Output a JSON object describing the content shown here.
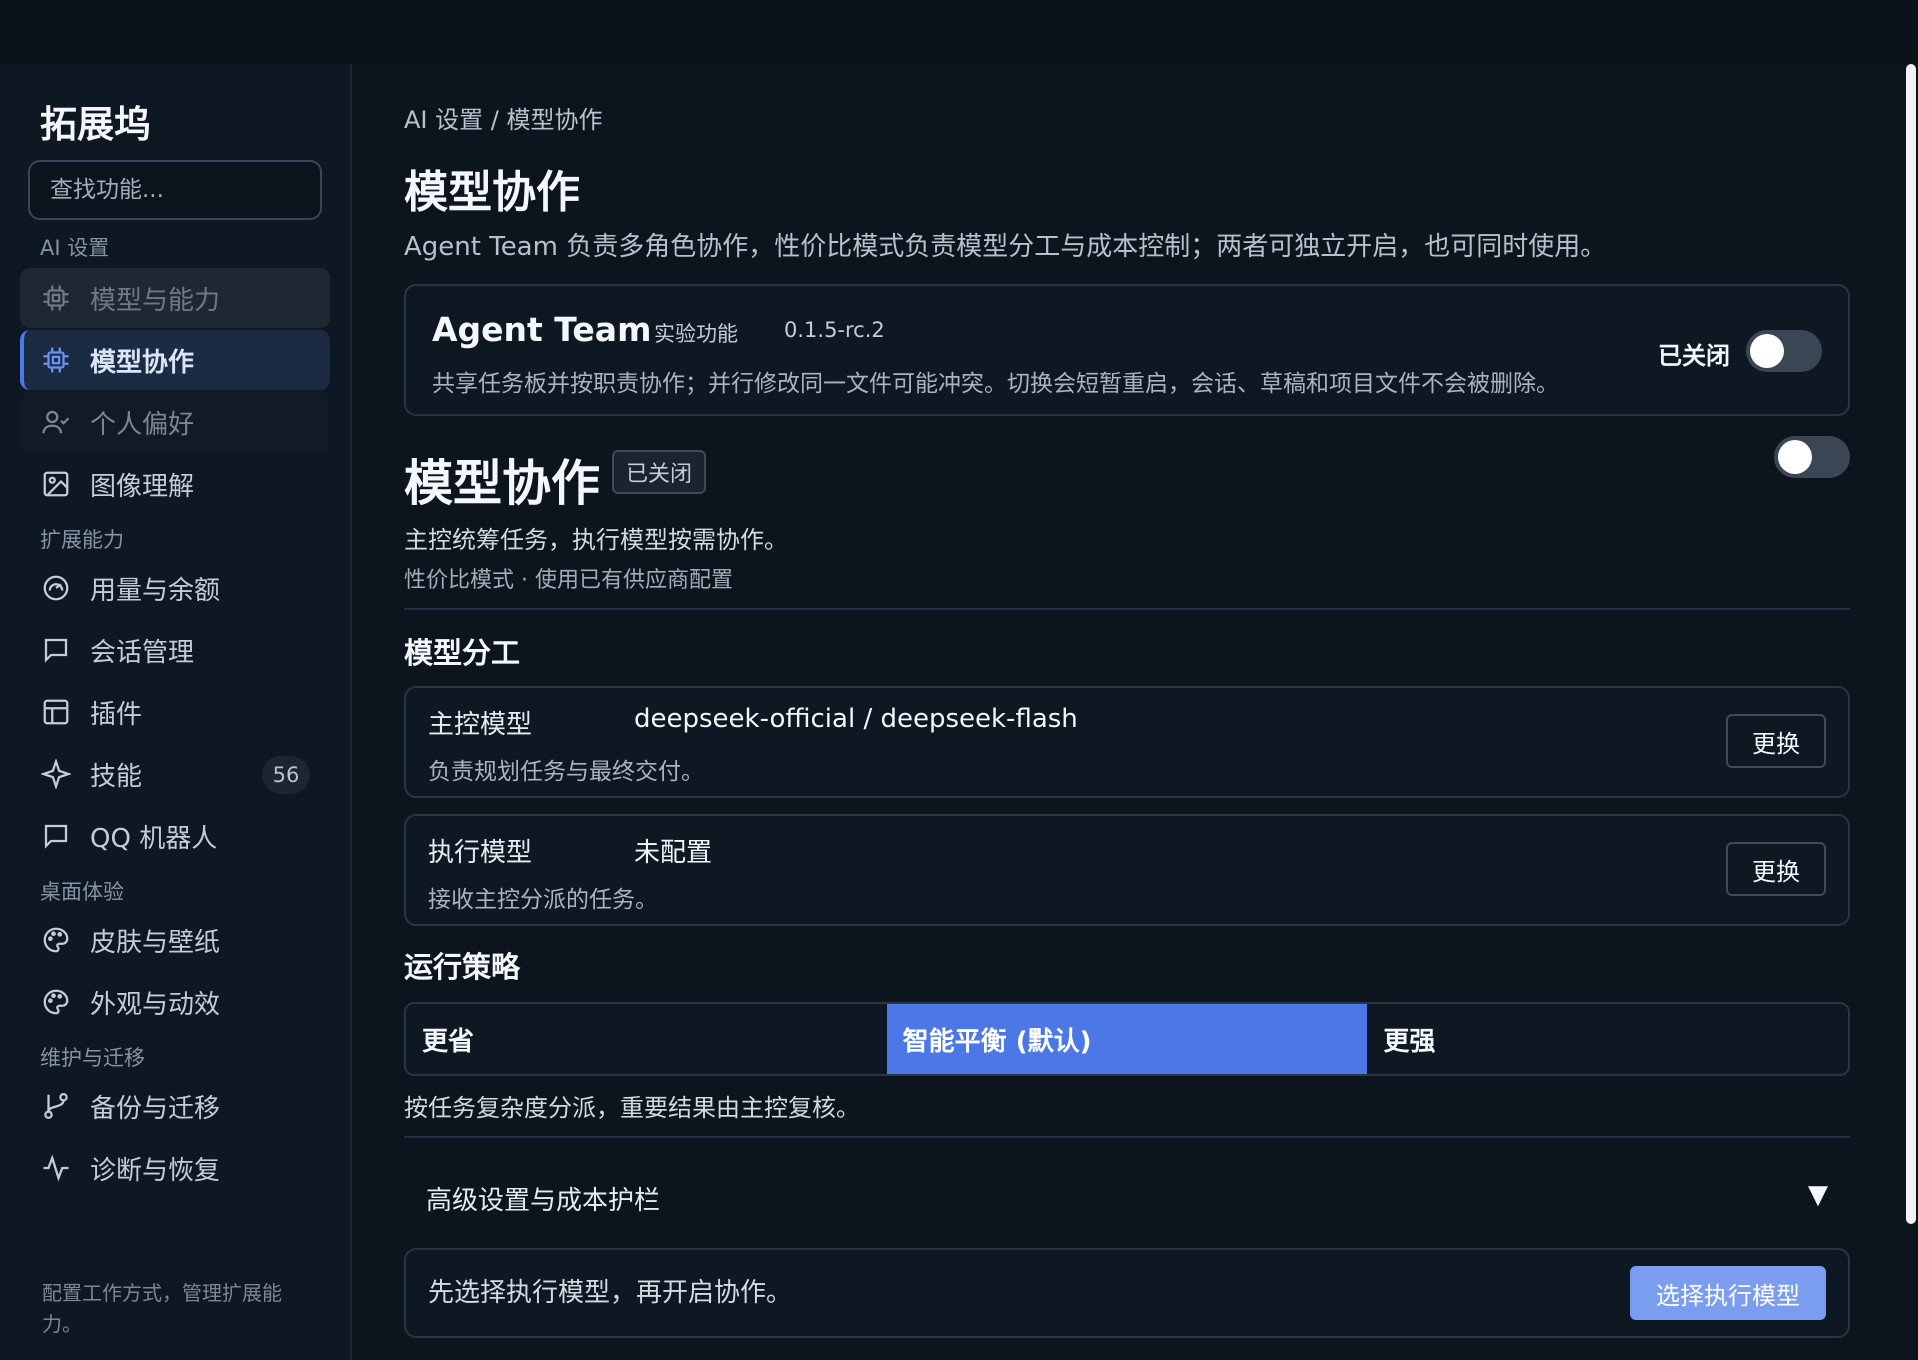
{
  "sidebar": {
    "brand": "拓展坞",
    "search_placeholder": "查找功能...",
    "groups": [
      "AI 设置",
      "扩展能力",
      "桌面体验",
      "维护与迁移"
    ],
    "items": [
      {
        "label": "模型与能力",
        "icon": "chip-icon"
      },
      {
        "label": "模型协作",
        "icon": "chip-icon"
      },
      {
        "label": "个人偏好",
        "icon": "user-check-icon"
      },
      {
        "label": "图像理解",
        "icon": "image-icon"
      },
      {
        "label": "用量与余额",
        "icon": "gauge-icon"
      },
      {
        "label": "会话管理",
        "icon": "chat-icon"
      },
      {
        "label": "插件",
        "icon": "layout-icon"
      },
      {
        "label": "技能",
        "icon": "sparkle-icon",
        "count": "56"
      },
      {
        "label": "QQ 机器人",
        "icon": "chat-icon"
      },
      {
        "label": "皮肤与壁纸",
        "icon": "palette-icon"
      },
      {
        "label": "外观与动效",
        "icon": "palette-icon"
      },
      {
        "label": "备份与迁移",
        "icon": "git-branch-icon"
      },
      {
        "label": "诊断与恢复",
        "icon": "pulse-icon"
      }
    ],
    "footer": "配置工作方式，管理扩展能力。"
  },
  "main": {
    "breadcrumb": "AI 设置 / 模型协作",
    "title": "模型协作",
    "description": "Agent Team 负责多角色协作，性价比模式负责模型分工与成本控制；两者可独立开启，也可同时使用。",
    "agent_team": {
      "title": "Agent Team",
      "tag": "实验功能",
      "version": "0.1.5-rc.2",
      "description": "共享任务板并按职责协作；并行修改同一文件可能冲突。切换会短暂重启，会话、草稿和项目文件不会被删除。",
      "state_label": "已关闭",
      "enabled": false
    },
    "collab": {
      "title": "模型协作",
      "badge": "已关闭",
      "description": "主控统筹任务，执行模型按需协作。",
      "sub": "性价比模式 · 使用已有供应商配置",
      "enabled": false
    },
    "division": {
      "title": "模型分工",
      "models": [
        {
          "label": "主控模型",
          "value": "deepseek-official / deepseek-flash",
          "description": "负责规划任务与最终交付。",
          "button": "更换"
        },
        {
          "label": "执行模型",
          "value": "未配置",
          "description": "接收主控分派的任务。",
          "button": "更换"
        }
      ]
    },
    "strategy": {
      "title": "运行策略",
      "options": [
        "更省",
        "智能平衡 (默认)",
        "更强"
      ],
      "selected": 1,
      "description": "按任务复杂度分派，重要结果由主控复核。"
    },
    "advanced": {
      "label": "高级设置与成本护栏",
      "arrow": "▼"
    },
    "footer_card": {
      "text": "先选择执行模型，再开启协作。",
      "button": "选择执行模型"
    }
  },
  "colors": {
    "accent": "#4b78e6",
    "primary_button": "#7a9df0",
    "background": "#0c141d"
  }
}
